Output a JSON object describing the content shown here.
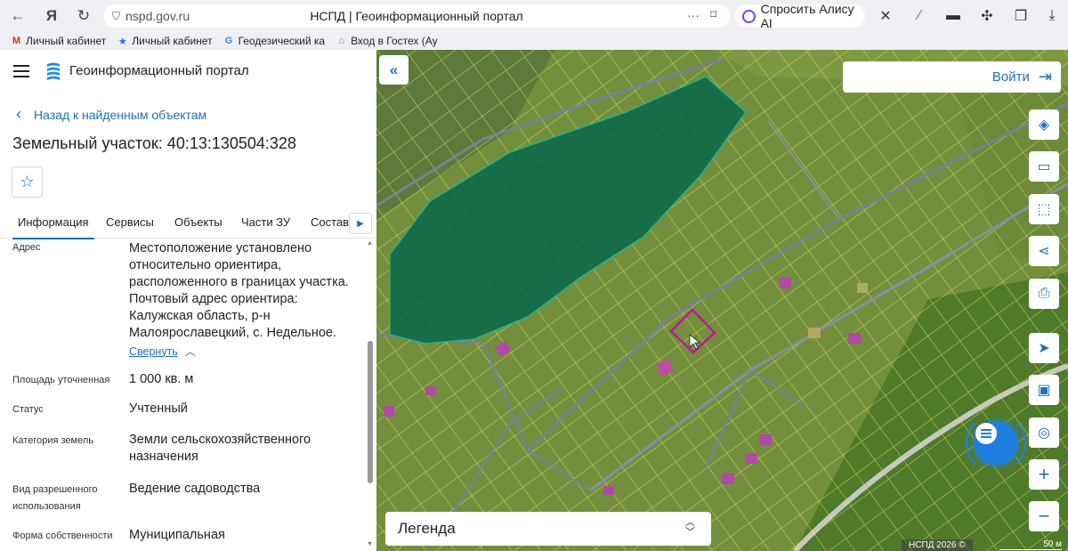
{
  "browser": {
    "url": "nspd.gov.ru",
    "tab_title": "НСПД | Геоинформационный портал",
    "alice_label": "Спросить Алису AI",
    "bookmarks": [
      {
        "label": "Личный кабинет",
        "icon": "gmail-icon"
      },
      {
        "label": "Личный кабинет",
        "icon": "star-icon"
      },
      {
        "label": "Геодезический ка",
        "icon": "google-icon"
      },
      {
        "label": "Вход в Гостех (Ау",
        "icon": "gostech-icon"
      }
    ]
  },
  "panel": {
    "app_title": "Геоинформационный портал",
    "back_label": "Назад к найденным объектам",
    "parcel_title": "Земельный участок: 40:13:130504:328",
    "tabs": [
      "Информация",
      "Сервисы",
      "Объекты",
      "Части ЗУ",
      "Состав"
    ],
    "active_tab": "Информация",
    "collapse_label": "Свернуть",
    "properties": [
      {
        "label": "Адрес",
        "value": [
          "Местоположение установлено",
          "относительно ориентира,",
          "расположенного в границах участка.",
          "Почтовый адрес ориентира:",
          "Калужская область, р-н",
          "Малоярославецкий, с. Недельное."
        ]
      },
      {
        "label": "Площадь уточненная",
        "value": [
          "1 000 кв. м"
        ]
      },
      {
        "label": "Статус",
        "value": [
          "Учтенный"
        ]
      },
      {
        "label": "Категория земель",
        "value": [
          "Земли сельскохозяйственного",
          "назначения"
        ]
      },
      {
        "label": "Вид разрешенного использования",
        "label_lines": [
          "Вид разрешенного",
          "использования"
        ],
        "value": [
          "Ведение садоводства"
        ]
      },
      {
        "label": "Форма собственности",
        "value": [
          "Муниципальная"
        ]
      }
    ]
  },
  "map": {
    "login_label": "Войти",
    "legend_label": "Легенда",
    "copyright": "НСПД 2026 ©",
    "scale_label": "50 м",
    "tools": [
      "layers-icon",
      "ruler-icon",
      "select-area-icon",
      "share-icon",
      "print-icon",
      "locate-icon",
      "minimap-icon",
      "search-location-icon",
      "zoom-in-icon",
      "zoom-out-icon"
    ],
    "colors": {
      "accent": "#1f6fb8",
      "forest": "#0f6b4a",
      "selected_parcel": "#c0169b",
      "parcel_lines": "#e8e36a"
    }
  }
}
